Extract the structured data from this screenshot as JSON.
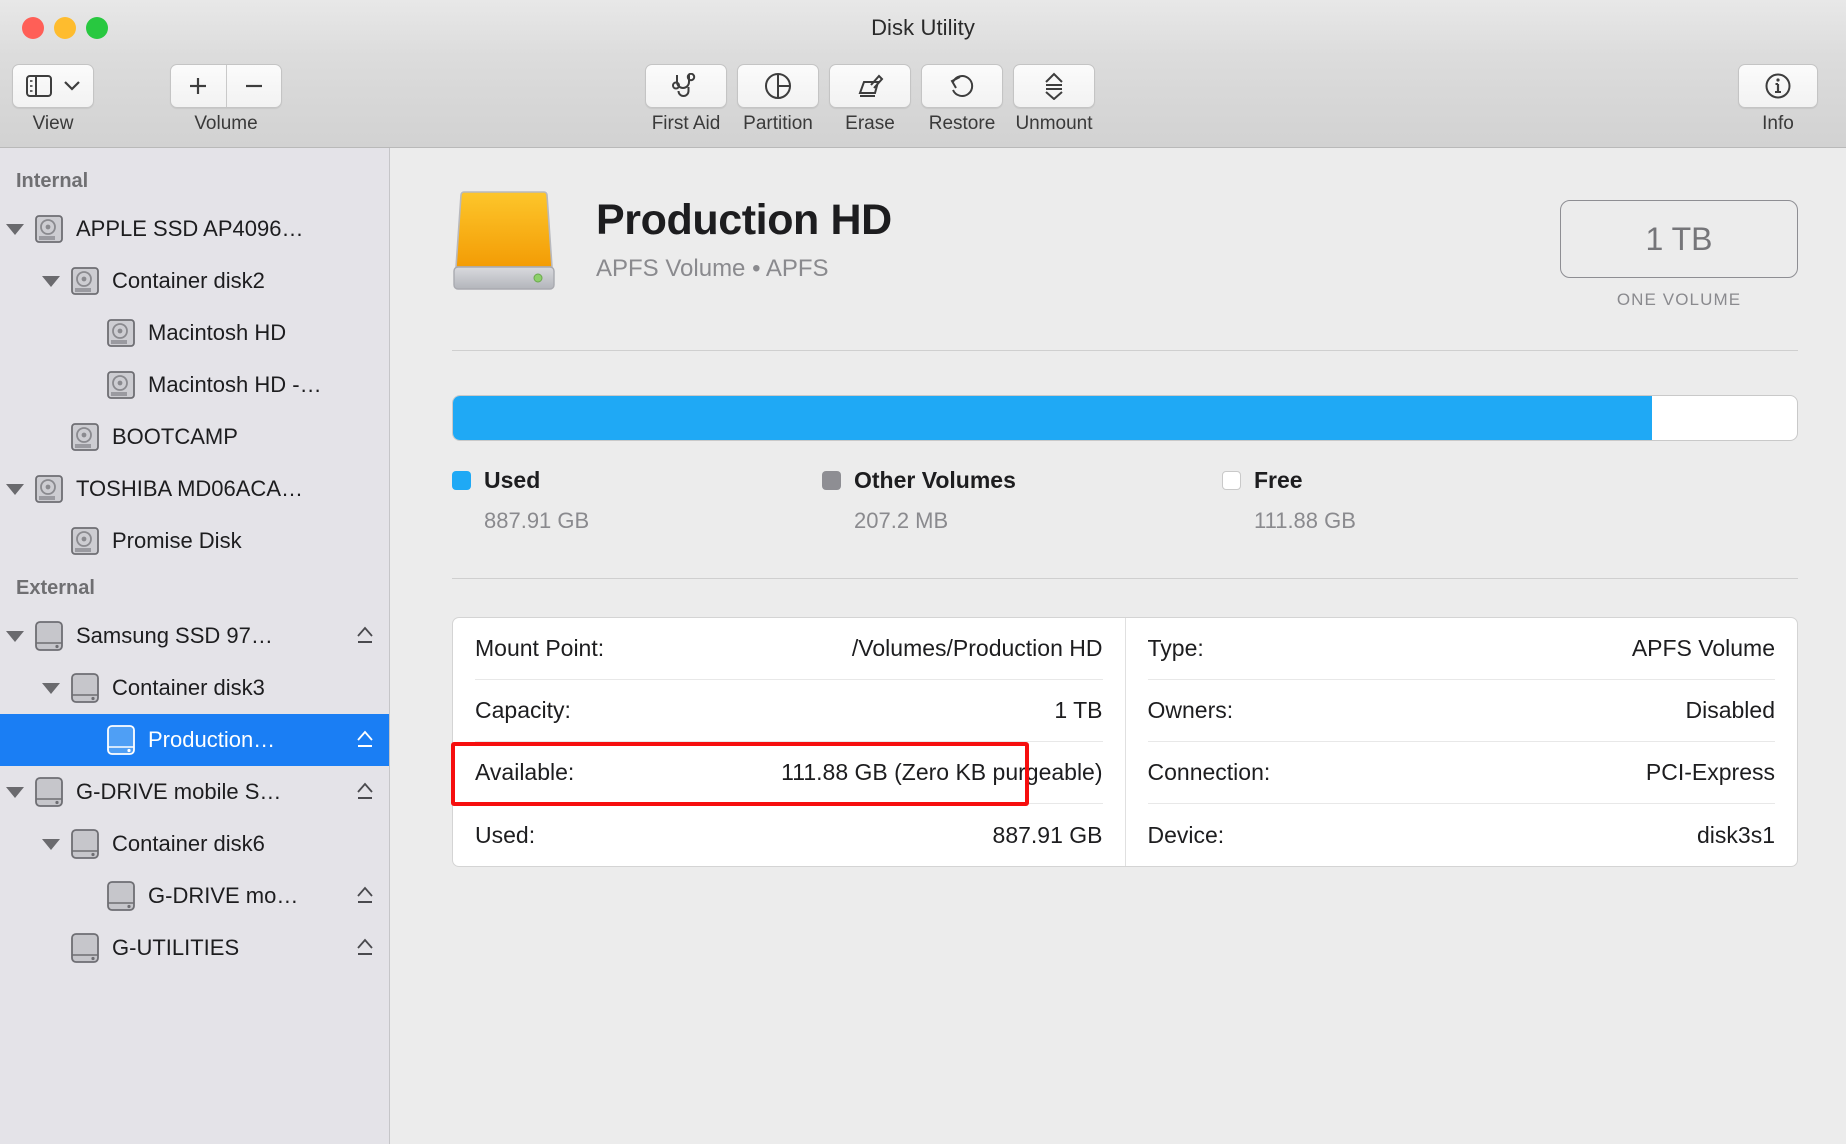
{
  "window": {
    "title": "Disk Utility"
  },
  "toolbar": {
    "view": {
      "label": "View",
      "icon": "sidebar-icon",
      "chevron": "chevron-down-icon"
    },
    "volume": {
      "label": "Volume",
      "add": "+",
      "remove": "−"
    },
    "items": [
      {
        "label": "First Aid",
        "icon": "stethoscope-icon"
      },
      {
        "label": "Partition",
        "icon": "pie-chart-icon"
      },
      {
        "label": "Erase",
        "icon": "erase-icon"
      },
      {
        "label": "Restore",
        "icon": "restore-icon"
      },
      {
        "label": "Unmount",
        "icon": "eject-icon"
      }
    ],
    "info": {
      "label": "Info",
      "icon": "info-circle-icon"
    }
  },
  "sidebar": {
    "sections": [
      {
        "header": "Internal",
        "items": [
          {
            "label": "APPLE SSD AP4096…",
            "indent": 0,
            "disclosure": true,
            "icon": "internal-disk-icon",
            "eject": false
          },
          {
            "label": "Container disk2",
            "indent": 1,
            "disclosure": true,
            "icon": "internal-disk-icon",
            "eject": false
          },
          {
            "label": "Macintosh HD",
            "indent": 2,
            "disclosure": false,
            "icon": "internal-disk-icon",
            "eject": false
          },
          {
            "label": "Macintosh HD -…",
            "indent": 2,
            "disclosure": false,
            "icon": "internal-disk-icon",
            "eject": false
          },
          {
            "label": "BOOTCAMP",
            "indent": 1,
            "disclosure": false,
            "icon": "internal-disk-icon",
            "eject": false
          },
          {
            "label": "TOSHIBA MD06ACA…",
            "indent": 0,
            "disclosure": true,
            "icon": "internal-disk-icon",
            "eject": false
          },
          {
            "label": "Promise Disk",
            "indent": 1,
            "disclosure": false,
            "icon": "internal-disk-icon",
            "eject": false
          }
        ]
      },
      {
        "header": "External",
        "items": [
          {
            "label": "Samsung SSD 97…",
            "indent": 0,
            "disclosure": true,
            "icon": "external-disk-icon",
            "eject": true
          },
          {
            "label": "Container disk3",
            "indent": 1,
            "disclosure": true,
            "icon": "external-disk-icon",
            "eject": false
          },
          {
            "label": "Production…",
            "indent": 2,
            "disclosure": false,
            "icon": "external-disk-icon",
            "eject": true,
            "selected": true
          },
          {
            "label": "G-DRIVE mobile S…",
            "indent": 0,
            "disclosure": true,
            "icon": "external-disk-icon",
            "eject": true
          },
          {
            "label": "Container disk6",
            "indent": 1,
            "disclosure": true,
            "icon": "external-disk-icon",
            "eject": false
          },
          {
            "label": "G-DRIVE mo…",
            "indent": 2,
            "disclosure": false,
            "icon": "external-disk-icon",
            "eject": true
          },
          {
            "label": "G-UTILITIES",
            "indent": 1,
            "disclosure": false,
            "icon": "external-disk-icon",
            "eject": true
          }
        ]
      }
    ]
  },
  "main": {
    "volume_name": "Production HD",
    "volume_subtitle": "APFS Volume • APFS",
    "capacity_badge": "1 TB",
    "capacity_caption": "ONE VOLUME",
    "storage": {
      "used_percent": 89.2,
      "legend": [
        {
          "name": "Used",
          "value": "887.91 GB",
          "color": "#1fa9f5"
        },
        {
          "name": "Other Volumes",
          "value": "207.2 MB",
          "color": "#8e8e93"
        },
        {
          "name": "Free",
          "value": "111.88 GB",
          "color": "#ffffff"
        }
      ]
    },
    "details_left": [
      {
        "label": "Mount Point:",
        "value": "/Volumes/Production HD"
      },
      {
        "label": "Capacity:",
        "value": "1 TB"
      },
      {
        "label": "Available:",
        "value": "111.88 GB (Zero KB purgeable)",
        "highlighted": true
      },
      {
        "label": "Used:",
        "value": "887.91 GB"
      }
    ],
    "details_right": [
      {
        "label": "Type:",
        "value": "APFS Volume"
      },
      {
        "label": "Owners:",
        "value": "Disabled"
      },
      {
        "label": "Connection:",
        "value": "PCI-Express"
      },
      {
        "label": "Device:",
        "value": "disk3s1"
      }
    ],
    "highlight_color": "#f60e0e"
  }
}
